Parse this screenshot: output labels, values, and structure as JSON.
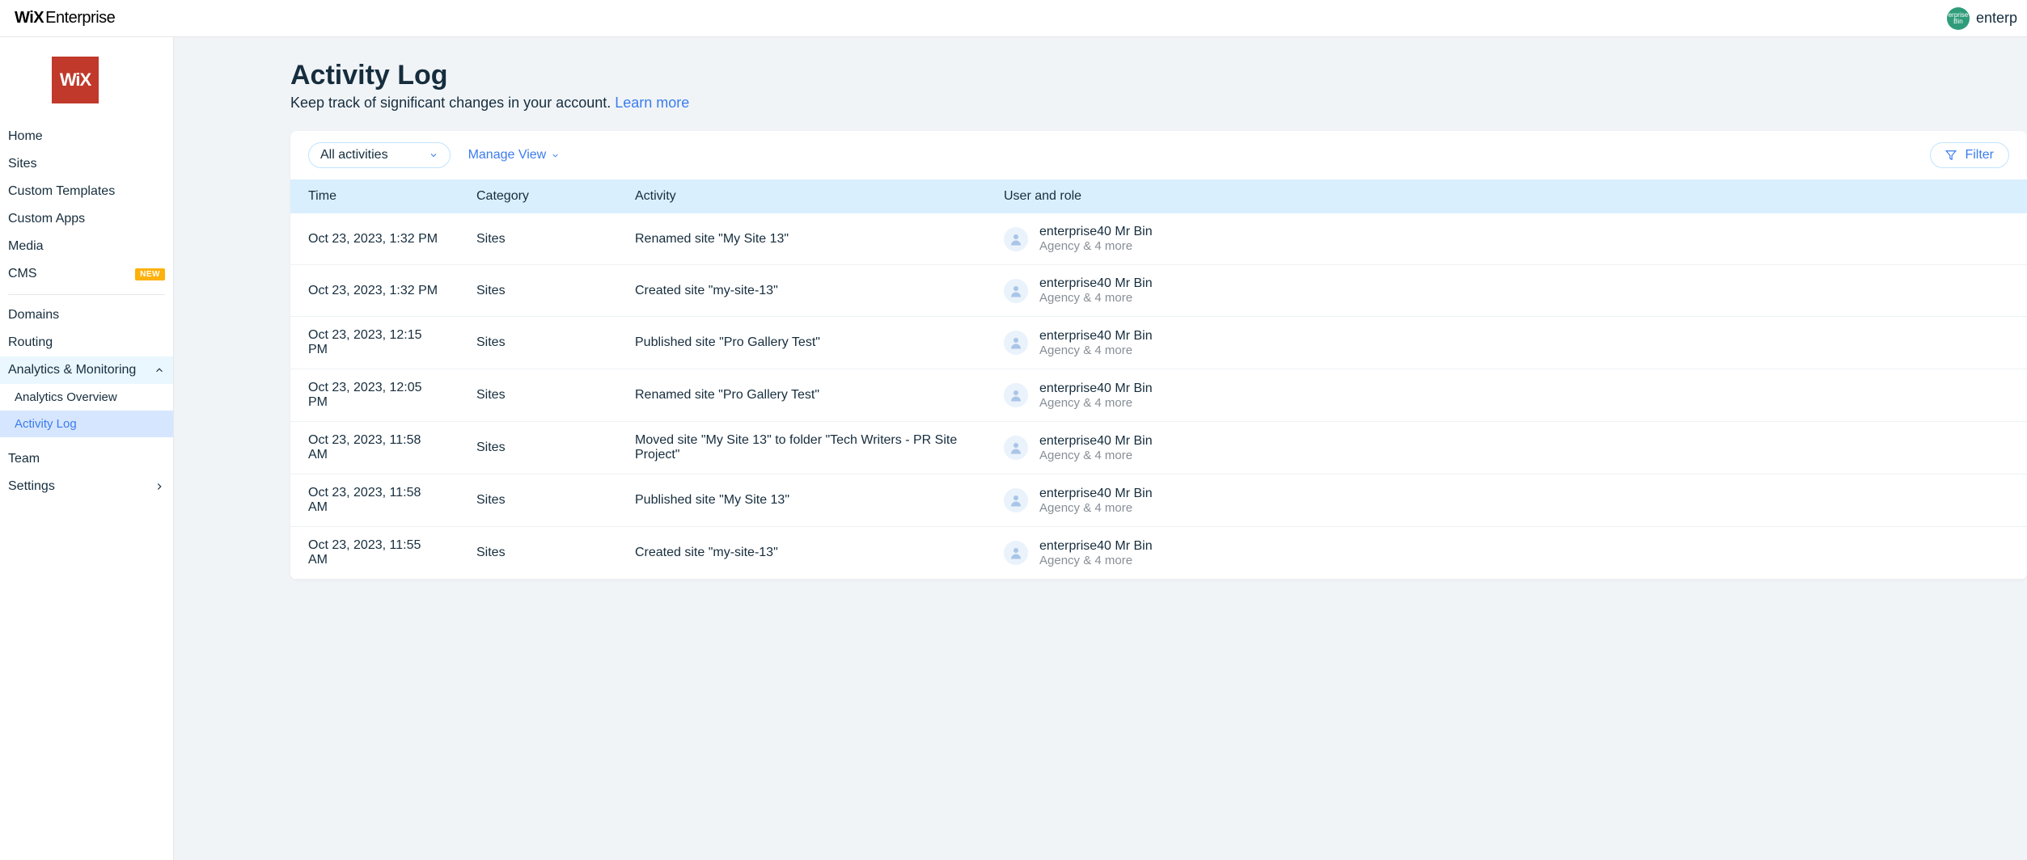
{
  "header": {
    "brand_wix": "WiX",
    "brand_rest": "Enterprise",
    "user_label": "enterp",
    "avatar_text": "erprise\nBin"
  },
  "sidebar": {
    "logo_text": "WiX",
    "items": [
      {
        "label": "Home"
      },
      {
        "label": "Sites"
      },
      {
        "label": "Custom Templates"
      },
      {
        "label": "Custom Apps"
      },
      {
        "label": "Media"
      },
      {
        "label": "CMS",
        "badge": "NEW"
      }
    ],
    "items2": [
      {
        "label": "Domains"
      },
      {
        "label": "Routing"
      }
    ],
    "analytics": {
      "label": "Analytics & Monitoring",
      "children": [
        {
          "label": "Analytics Overview"
        },
        {
          "label": "Activity Log",
          "active": true
        }
      ]
    },
    "items3": [
      {
        "label": "Team"
      },
      {
        "label": "Settings",
        "chevron": true
      }
    ]
  },
  "page": {
    "title": "Activity Log",
    "subtitle": "Keep track of significant changes in your account. ",
    "learn_more": "Learn more"
  },
  "toolbar": {
    "dropdown_label": "All activities",
    "manage_view": "Manage View",
    "filter": "Filter"
  },
  "table": {
    "cols": {
      "time": "Time",
      "category": "Category",
      "activity": "Activity",
      "user": "User and role"
    },
    "default_user": {
      "name": "enterprise40 Mr Bin",
      "role": "Agency & 4 more"
    },
    "rows": [
      {
        "time": "Oct 23, 2023, 1:32 PM",
        "category": "Sites",
        "activity": "Renamed site \"My Site 13\""
      },
      {
        "time": "Oct 23, 2023, 1:32 PM",
        "category": "Sites",
        "activity": "Created site \"my-site-13\""
      },
      {
        "time": "Oct 23, 2023, 12:15 PM",
        "category": "Sites",
        "activity": "Published site \"Pro Gallery Test\""
      },
      {
        "time": "Oct 23, 2023, 12:05 PM",
        "category": "Sites",
        "activity": "Renamed site \"Pro Gallery Test\""
      },
      {
        "time": "Oct 23, 2023, 11:58 AM",
        "category": "Sites",
        "activity": "Moved site \"My Site 13\" to folder \"Tech Writers - PR Site Project\""
      },
      {
        "time": "Oct 23, 2023, 11:58 AM",
        "category": "Sites",
        "activity": "Published site \"My Site 13\""
      },
      {
        "time": "Oct 23, 2023, 11:55 AM",
        "category": "Sites",
        "activity": "Created site \"my-site-13\""
      }
    ]
  }
}
